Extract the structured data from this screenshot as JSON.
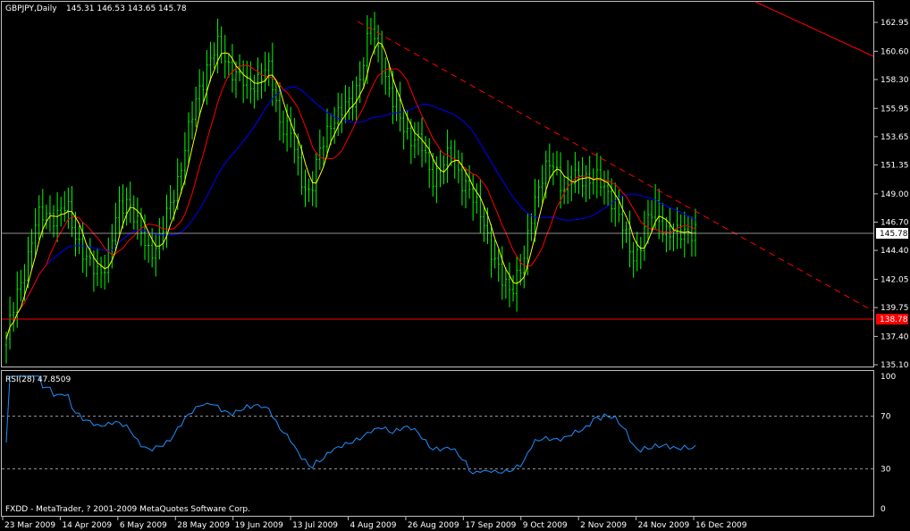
{
  "header": {
    "symbol": "GBPJPY,Daily",
    "ohlc": "145.31 146.53 143.65 145.78"
  },
  "rsi_panel": {
    "label": "RSI(28) 47.8509"
  },
  "footer": {
    "copyright": "FXDD - MetaTrader, ? 2001-2009 MetaQuotes Software Corp."
  },
  "colors": {
    "background": "#000000",
    "frame": "#c0c0c0",
    "candle": "#00ff00",
    "ma_fast": "#ffff00",
    "ma_mid": "#ff0000",
    "ma_slow": "#0000ff",
    "rsi_line": "#1e90ff",
    "trend_line": "#ff0000",
    "support_line": "#ff0000",
    "current_price_line": "#c0c0c0",
    "price_tag_current": "#ffffff",
    "price_tag_support": "#ff0000"
  },
  "chart_data": [
    {
      "type": "candlestick",
      "title": "GBPJPY,Daily",
      "price_ticks": [
        "162.95",
        "160.60",
        "158.30",
        "155.95",
        "153.65",
        "151.35",
        "149.00",
        "146.70",
        "144.40",
        "142.05",
        "139.75",
        "137.40",
        "135.10"
      ],
      "ylim": [
        135.1,
        162.95
      ],
      "date_ticks": [
        "23 Mar 2009",
        "14 Apr 2009",
        "6 May 2009",
        "28 May 2009",
        "19 Jun 2009",
        "13 Jul 2009",
        "4 Aug 2009",
        "26 Aug 2009",
        "17 Sep 2009",
        "9 Oct 2009",
        "2 Nov 2009",
        "24 Nov 2009",
        "16 Dec 2009"
      ],
      "current_price": "145.78",
      "support_price": "138.78",
      "close_series": [
        137.2,
        140.5,
        143.5,
        146.8,
        147.5,
        147.2,
        147.9,
        145.5,
        143.2,
        142.8,
        143.5,
        147.6,
        148.8,
        146.2,
        144.4,
        145.0,
        147.5,
        150.5,
        154.0,
        157.5,
        159.8,
        161.0,
        159.5,
        158.2,
        157.8,
        158.5,
        159.0,
        155.0,
        154.0,
        150.5,
        149.0,
        152.5,
        155.0,
        155.5,
        156.5,
        158.8,
        162.5,
        160.0,
        156.5,
        155.0,
        153.5,
        152.8,
        150.5,
        151.0,
        152.5,
        150.0,
        148.5,
        147.5,
        143.5,
        142.0,
        141.5,
        143.0,
        148.5,
        150.5,
        151.5,
        149.5,
        150.2,
        150.5,
        150.2,
        149.5,
        148.5,
        145.5,
        143.8,
        146.0,
        148.0,
        146.0,
        145.5,
        146.2,
        145.78
      ],
      "rsi": {
        "title": "RSI(28) 47.8509",
        "period": 28,
        "last": 47.8509,
        "levels": [
          70,
          30
        ],
        "ticks": [
          "100",
          "70",
          "30",
          "0"
        ],
        "ylim": [
          0,
          100
        ]
      }
    }
  ]
}
